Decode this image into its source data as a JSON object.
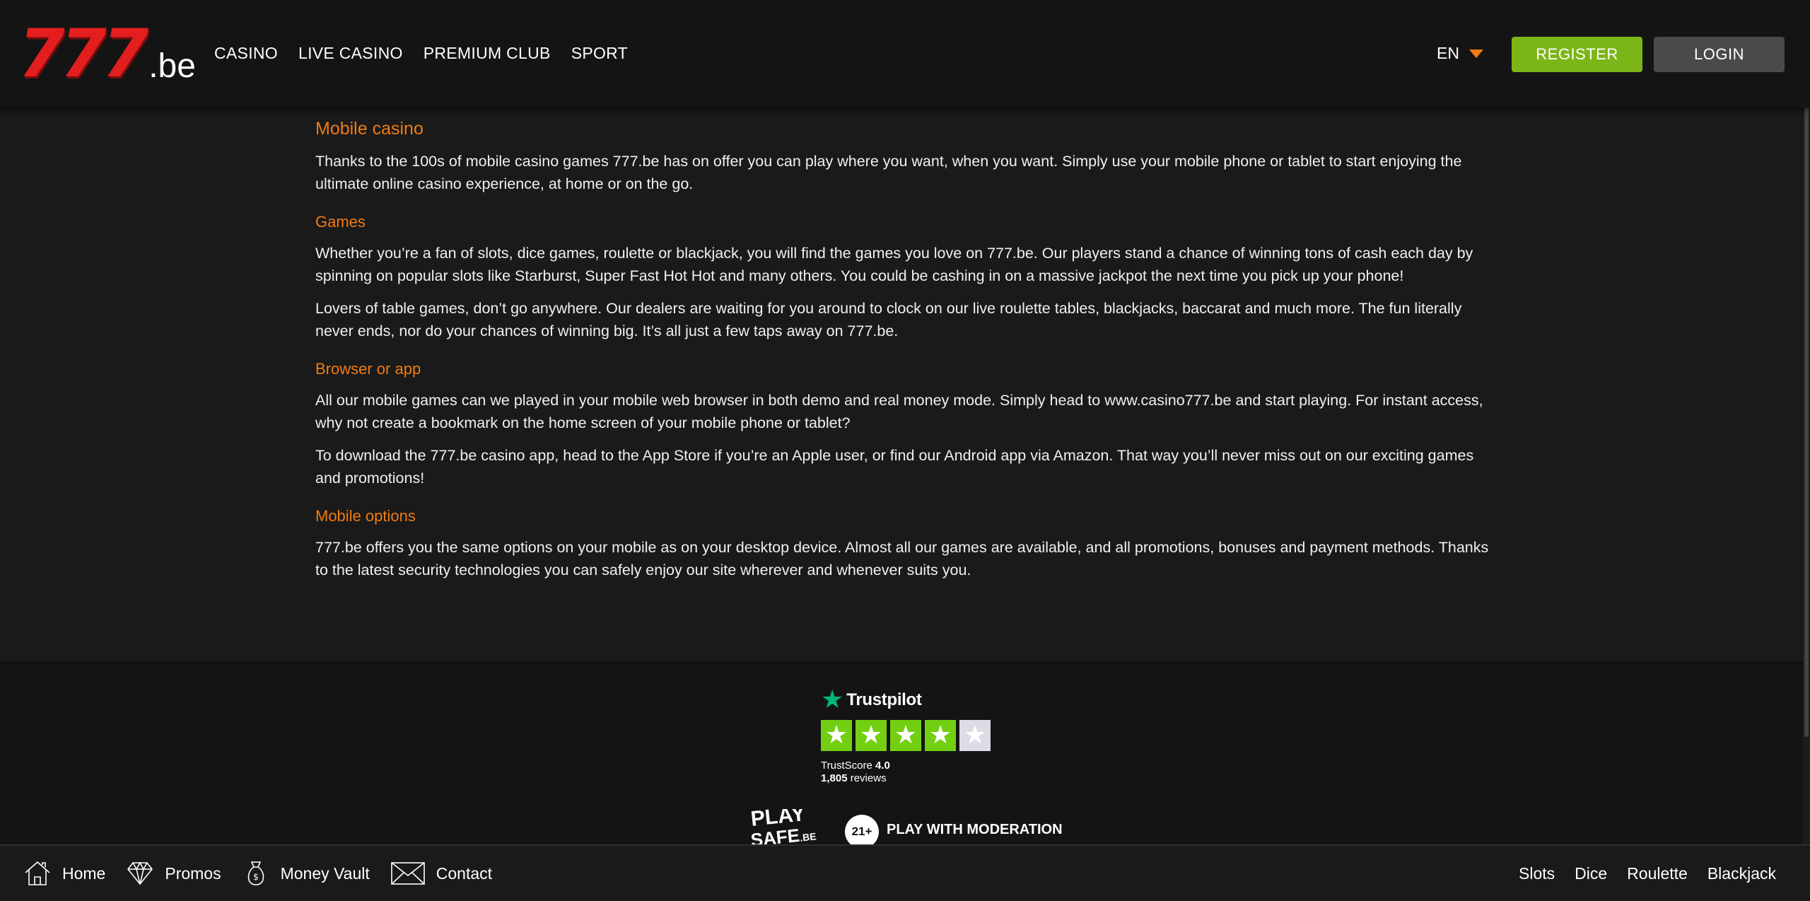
{
  "header": {
    "logo": {
      "main": "777",
      "suffix": ".be"
    },
    "nav": [
      {
        "label": "CASINO"
      },
      {
        "label": "LIVE CASINO"
      },
      {
        "label": "PREMIUM CLUB"
      },
      {
        "label": "SPORT"
      }
    ],
    "language": "EN",
    "register_label": "REGISTER",
    "login_label": "LOGIN"
  },
  "content": {
    "title": "Mobile casino",
    "intro": "Thanks to the 100s of mobile casino games 777.be has on offer you can play where you want, when you want. Simply use your mobile phone or tablet to start enjoying the ultimate online casino experience, at home or on the go.",
    "sections": [
      {
        "heading": "Games",
        "paragraphs": [
          "Whether you’re a fan of slots, dice games, roulette or blackjack, you will find the games you love on 777.be. Our players stand a chance of winning tons of cash each day by spinning on popular slots like Starburst, Super Fast Hot Hot and many others. You could be cashing in on a massive jackpot the next time you pick up your phone!",
          "Lovers of table games, don’t go anywhere. Our dealers are waiting for you around to clock on our live roulette tables, blackjacks, baccarat and much more. The fun literally never ends, nor do your chances of winning big. It’s all just a few taps away on 777.be."
        ]
      },
      {
        "heading": "Browser or app",
        "paragraphs": [
          "All our mobile games can we played in your mobile web browser in both demo and real money mode. Simply head to www.casino777.be and start playing. For instant access, why not create a bookmark on the home screen of your mobile phone or tablet?",
          "To download the 777.be casino app, head to the App Store if you’re an Apple user, or find our Android app via Amazon. That way you’ll never miss out on our exciting games and promotions!"
        ]
      },
      {
        "heading": "Mobile options",
        "paragraphs": [
          "777.be offers you the same options on your mobile as on your desktop device. Almost all our games are available, and all promotions, bonuses and payment methods. Thanks to the latest security technologies you can safely enjoy our site wherever and whenever suits you."
        ]
      }
    ]
  },
  "footer": {
    "trustpilot": {
      "brand": "Trustpilot",
      "stars_filled": 4,
      "stars_total": 5,
      "score_label": "TrustScore",
      "score_value": "4.0",
      "reviews_count": "1,805",
      "reviews_label": "reviews"
    },
    "playsafe": {
      "line1": "PLAY",
      "line2": "SAFE",
      "line2_suffix": ".BE"
    },
    "age_badge": "21+",
    "moderation_text": "PLAY WITH MODERATION"
  },
  "bottom_bar": {
    "left": [
      {
        "label": "Home",
        "icon": "home-icon"
      },
      {
        "label": "Promos",
        "icon": "diamond-icon"
      },
      {
        "label": "Money Vault",
        "icon": "money-bag-icon"
      },
      {
        "label": "Contact",
        "icon": "envelope-icon"
      }
    ],
    "right": [
      {
        "label": "Slots"
      },
      {
        "label": "Dice"
      },
      {
        "label": "Roulette"
      },
      {
        "label": "Blackjack"
      }
    ]
  },
  "colors": {
    "accent": "#f07b14",
    "register": "#7cb518",
    "login": "#4a4a4a",
    "logo_red": "#e21e1e",
    "trustpilot_green": "#00b67a",
    "star_green": "#73cf11"
  }
}
